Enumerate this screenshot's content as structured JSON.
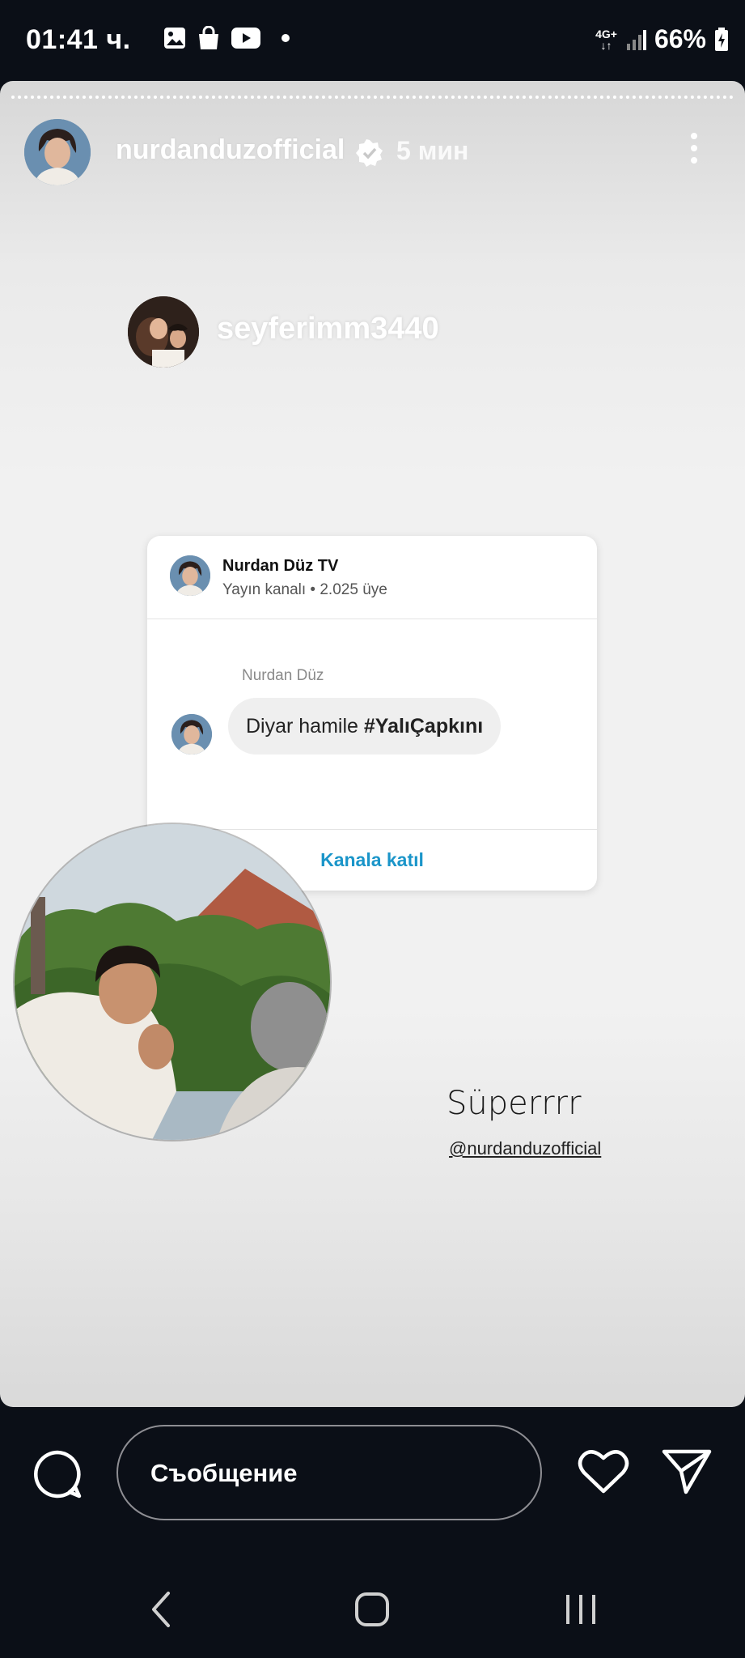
{
  "status_bar": {
    "time": "01:41 ч.",
    "network": "4G+",
    "battery": "66%",
    "icons": [
      "image-icon",
      "shopping-bag-icon",
      "youtube-icon",
      "notification-dot-icon",
      "signal-icon",
      "battery-charging-icon"
    ]
  },
  "story": {
    "owner": "nurdanduzofficial",
    "verified": true,
    "time_ago": "5 мин",
    "mention_username": "seyferimm3440",
    "caption": "Süperrrr",
    "caption_mention": "@nurdanduzofficial"
  },
  "channel_card": {
    "title": "Nurdan Düz TV",
    "subtitle": "Yayın kanalı • 2.025 üye",
    "sender": "Nurdan Düz",
    "message_text": "Diyar hamile ",
    "message_hashtag": "#YalıÇapkını",
    "join_label": "Kanala katıl"
  },
  "reply_bar": {
    "placeholder": "Съобщение"
  },
  "colors": {
    "background": "#0b0f17",
    "link_blue": "#1a95c9"
  }
}
